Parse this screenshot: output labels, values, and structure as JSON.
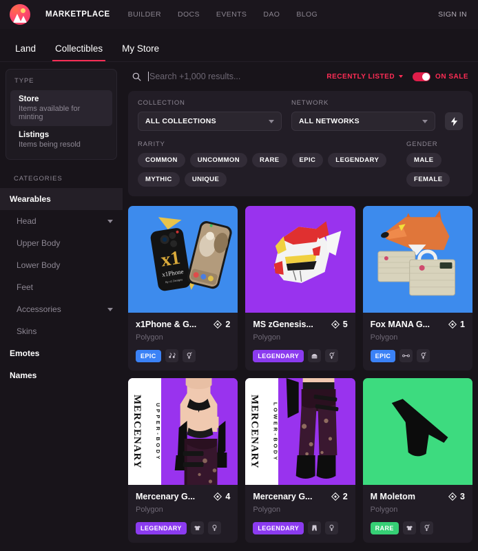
{
  "navbar": {
    "logo_icon": "decentraland-logo-icon",
    "brand": "MARKETPLACE",
    "links": [
      "BUILDER",
      "DOCS",
      "EVENTS",
      "DAO",
      "BLOG"
    ],
    "signin": "SIGN IN"
  },
  "subnav": {
    "tabs": [
      {
        "label": "Land",
        "active": false
      },
      {
        "label": "Collectibles",
        "active": true
      },
      {
        "label": "My Store",
        "active": false
      }
    ]
  },
  "sidebar": {
    "type_label": "TYPE",
    "types": [
      {
        "title": "Store",
        "subtitle": "Items available for minting",
        "active": true
      },
      {
        "title": "Listings",
        "subtitle": "Items being resold",
        "active": false
      }
    ],
    "categories_label": "CATEGORIES",
    "categories": [
      {
        "label": "Wearables",
        "level": "top",
        "active": true,
        "caret": false
      },
      {
        "label": "Head",
        "level": "sub",
        "active": false,
        "caret": true
      },
      {
        "label": "Upper Body",
        "level": "sub",
        "active": false,
        "caret": false
      },
      {
        "label": "Lower Body",
        "level": "sub",
        "active": false,
        "caret": false
      },
      {
        "label": "Feet",
        "level": "sub",
        "active": false,
        "caret": false
      },
      {
        "label": "Accessories",
        "level": "sub",
        "active": false,
        "caret": true
      },
      {
        "label": "Skins",
        "level": "sub",
        "active": false,
        "caret": false
      },
      {
        "label": "Emotes",
        "level": "top",
        "active": false,
        "caret": false
      },
      {
        "label": "Names",
        "level": "top",
        "active": false,
        "caret": false
      }
    ]
  },
  "search": {
    "icon": "search-icon",
    "placeholder": "Search +1,000 results...",
    "value": "",
    "sort_by": "RECENTLY LISTED",
    "on_sale_label": "ON SALE",
    "on_sale_enabled": true,
    "accent_color": "#ff2d55"
  },
  "filters": {
    "collection_label": "COLLECTION",
    "collection_value": "ALL COLLECTIONS",
    "network_label": "NETWORK",
    "network_value": "ALL NETWORKS",
    "bolt_icon": "lightning-bolt-icon",
    "rarity_label": "RARITY",
    "rarities": [
      "COMMON",
      "UNCOMMON",
      "RARE",
      "EPIC",
      "LEGENDARY",
      "MYTHIC",
      "UNIQUE"
    ],
    "gender_label": "GENDER",
    "genders": [
      "MALE",
      "FEMALE"
    ]
  },
  "rarity_colors": {
    "EPIC": "#3b82f6",
    "LEGENDARY": "#8b3bef",
    "RARE": "#36cf75"
  },
  "cards": [
    {
      "title": "x1Phone & G...",
      "network": "Polygon",
      "price": "2",
      "price_icon": "mana-diamond-icon",
      "rarity": "EPIC",
      "rarity_color": "#3b82f6",
      "icons": [
        "earring-icon",
        "unisex-icon"
      ],
      "art": "x1phone",
      "bg": "#3d8bed"
    },
    {
      "title": "MS zGenesis...",
      "network": "Polygon",
      "price": "5",
      "price_icon": "mana-diamond-icon",
      "rarity": "LEGENDARY",
      "rarity_color": "#8b3bef",
      "icons": [
        "helmet-icon",
        "unisex-icon"
      ],
      "art": "helmet",
      "bg": "#9933ee"
    },
    {
      "title": "Fox MANA G...",
      "network": "Polygon",
      "price": "1",
      "price_icon": "mana-diamond-icon",
      "rarity": "EPIC",
      "rarity_color": "#3b82f6",
      "icons": [
        "mask-icon",
        "unisex-icon"
      ],
      "art": "fox",
      "bg": "#3d8bed"
    },
    {
      "title": "Mercenary G...",
      "network": "Polygon",
      "price": "4",
      "price_icon": "mana-diamond-icon",
      "rarity": "LEGENDARY",
      "rarity_color": "#8b3bef",
      "icons": [
        "shirt-icon",
        "female-icon"
      ],
      "art": "mercenary-upper",
      "bg": "#9933ee",
      "strip_word": "MERCENARY",
      "strip_word2": "UPPER-BODY"
    },
    {
      "title": "Mercenary G...",
      "network": "Polygon",
      "price": "2",
      "price_icon": "mana-diamond-icon",
      "rarity": "LEGENDARY",
      "rarity_color": "#8b3bef",
      "icons": [
        "pants-icon",
        "female-icon"
      ],
      "art": "mercenary-lower",
      "bg": "#9933ee",
      "strip_word": "MERCENARY",
      "strip_word2": "LOWER-BODY"
    },
    {
      "title": "M Moletom",
      "network": "Polygon",
      "price": "3",
      "price_icon": "mana-diamond-icon",
      "rarity": "RARE",
      "rarity_color": "#36cf75",
      "icons": [
        "shirt-icon",
        "unisex-icon"
      ],
      "art": "moletom",
      "bg": "#3ddb7f"
    }
  ]
}
